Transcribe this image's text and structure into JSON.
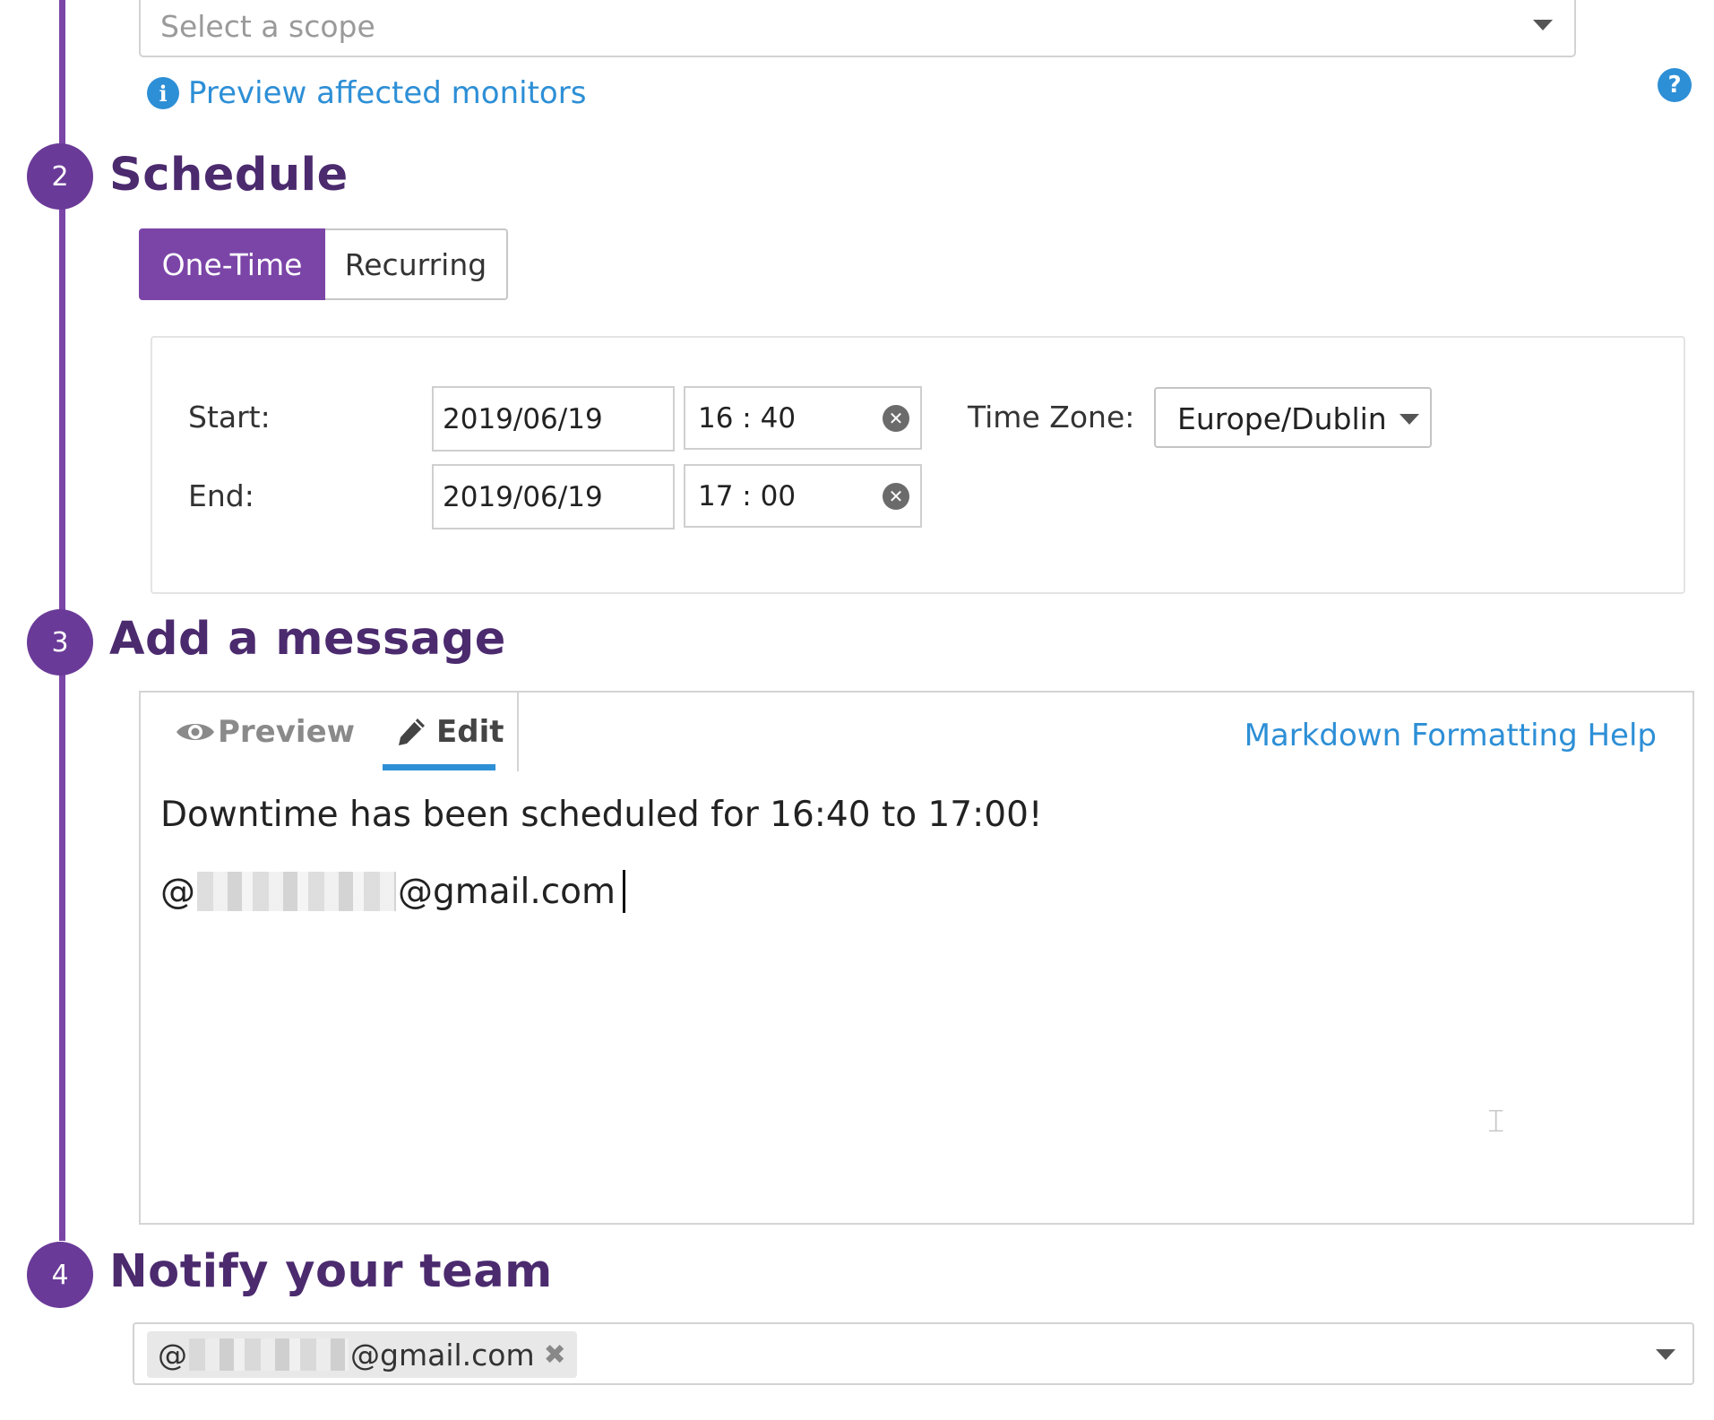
{
  "scope": {
    "placeholder": "Select a scope",
    "preview_link": "Preview affected monitors",
    "info_glyph": "i",
    "help_glyph": "?"
  },
  "steps": [
    {
      "number": "2",
      "title": "Schedule"
    },
    {
      "number": "3",
      "title": "Add a message"
    },
    {
      "number": "4",
      "title": "Notify your team"
    }
  ],
  "schedule": {
    "modes": [
      "One-Time",
      "Recurring"
    ],
    "selected_mode": "One-Time",
    "start_label": "Start:",
    "end_label": "End:",
    "start_date": "2019/06/19",
    "start_time": "16 : 40",
    "end_date": "2019/06/19",
    "end_time": "17 : 00",
    "timezone_label": "Time Zone:",
    "timezone_value": "Europe/Dublin"
  },
  "message": {
    "tabs": [
      "Preview",
      "Edit"
    ],
    "active_tab": "Edit",
    "markdown_help": "Markdown Formatting Help",
    "line1": "Downtime has been scheduled for 16:40 to 17:00!",
    "mention_prefix": "@",
    "mention_suffix": "@gmail.com"
  },
  "notify": {
    "chip_prefix": "@",
    "chip_suffix": "@gmail.com",
    "remove_glyph": "✖"
  },
  "colors": {
    "accent_purple": "#7b45a8",
    "heading_purple": "#4b2a6e",
    "link_blue": "#2d8fd6"
  }
}
